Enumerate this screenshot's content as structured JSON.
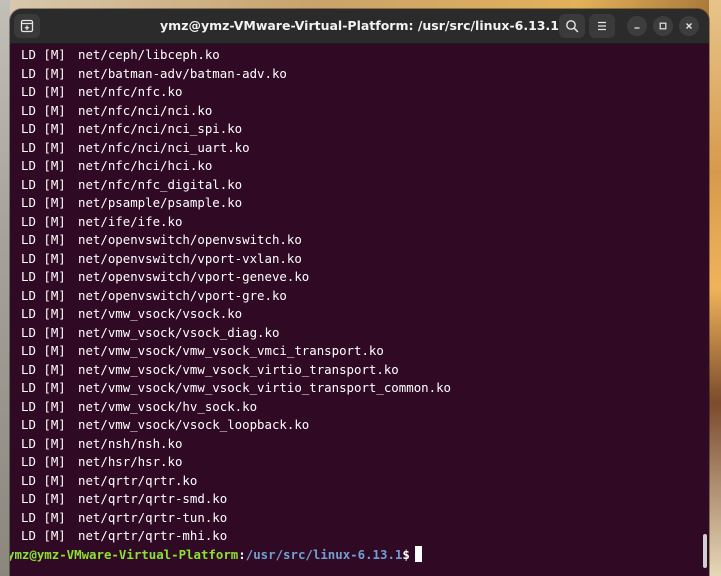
{
  "window": {
    "title": "ymz@ymz-VMware-Virtual-Platform: /usr/src/linux-6.13.1"
  },
  "header": {
    "new_tab_icon": "new-tab-icon",
    "search_icon": "search-icon",
    "menu_icon": "hamburger-menu-icon",
    "minimize_icon": "minimize-icon",
    "maximize_icon": "maximize-icon",
    "close_icon": "close-icon"
  },
  "terminal": {
    "lines": [
      {
        "tag": "LD [M]",
        "path": "net/ceph/libceph.ko"
      },
      {
        "tag": "LD [M]",
        "path": "net/batman-adv/batman-adv.ko"
      },
      {
        "tag": "LD [M]",
        "path": "net/nfc/nfc.ko"
      },
      {
        "tag": "LD [M]",
        "path": "net/nfc/nci/nci.ko"
      },
      {
        "tag": "LD [M]",
        "path": "net/nfc/nci/nci_spi.ko"
      },
      {
        "tag": "LD [M]",
        "path": "net/nfc/nci/nci_uart.ko"
      },
      {
        "tag": "LD [M]",
        "path": "net/nfc/hci/hci.ko"
      },
      {
        "tag": "LD [M]",
        "path": "net/nfc/nfc_digital.ko"
      },
      {
        "tag": "LD [M]",
        "path": "net/psample/psample.ko"
      },
      {
        "tag": "LD [M]",
        "path": "net/ife/ife.ko"
      },
      {
        "tag": "LD [M]",
        "path": "net/openvswitch/openvswitch.ko"
      },
      {
        "tag": "LD [M]",
        "path": "net/openvswitch/vport-vxlan.ko"
      },
      {
        "tag": "LD [M]",
        "path": "net/openvswitch/vport-geneve.ko"
      },
      {
        "tag": "LD [M]",
        "path": "net/openvswitch/vport-gre.ko"
      },
      {
        "tag": "LD [M]",
        "path": "net/vmw_vsock/vsock.ko"
      },
      {
        "tag": "LD [M]",
        "path": "net/vmw_vsock/vsock_diag.ko"
      },
      {
        "tag": "LD [M]",
        "path": "net/vmw_vsock/vmw_vsock_vmci_transport.ko"
      },
      {
        "tag": "LD [M]",
        "path": "net/vmw_vsock/vmw_vsock_virtio_transport.ko"
      },
      {
        "tag": "LD [M]",
        "path": "net/vmw_vsock/vmw_vsock_virtio_transport_common.ko"
      },
      {
        "tag": "LD [M]",
        "path": "net/vmw_vsock/hv_sock.ko"
      },
      {
        "tag": "LD [M]",
        "path": "net/vmw_vsock/vsock_loopback.ko"
      },
      {
        "tag": "LD [M]",
        "path": "net/nsh/nsh.ko"
      },
      {
        "tag": "LD [M]",
        "path": "net/hsr/hsr.ko"
      },
      {
        "tag": "LD [M]",
        "path": "net/qrtr/qrtr.ko"
      },
      {
        "tag": "LD [M]",
        "path": "net/qrtr/qrtr-smd.ko"
      },
      {
        "tag": "LD [M]",
        "path": "net/qrtr/qrtr-tun.ko"
      },
      {
        "tag": "LD [M]",
        "path": "net/qrtr/qrtr-mhi.ko"
      }
    ],
    "prompt": {
      "user_host": "ymz@ymz-VMware-Virtual-Platform",
      "colon": ":",
      "path": "/usr/src/linux-6.13.1",
      "dollar": "$"
    }
  },
  "colors": {
    "terminal_bg": "#300a24",
    "prompt_user": "#8ae234",
    "prompt_path": "#729fcf",
    "titlebar_bg": "#2b2b2b"
  }
}
